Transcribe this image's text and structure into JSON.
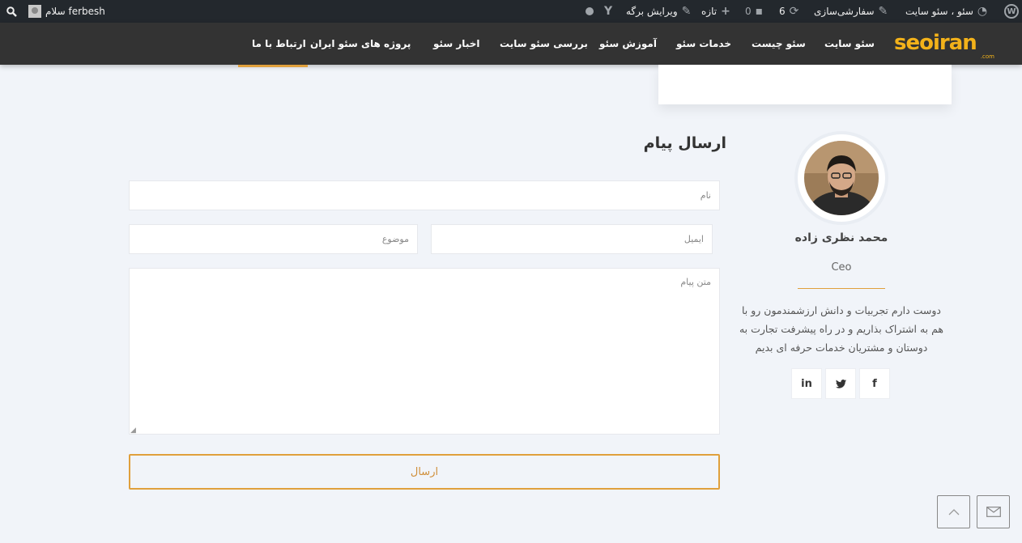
{
  "adminbar": {
    "site_name": "سئو ، سئو سایت",
    "customize": "سفارشی‌سازی",
    "updates_count": "6",
    "comments_count": "0",
    "new_label": "تازه",
    "edit_page": "ویرایش برگه",
    "greeting": "سلام ferbesh"
  },
  "logo": {
    "text": "seoiran",
    "sub": ".com"
  },
  "nav": {
    "items": [
      {
        "label": "سئو سایت"
      },
      {
        "label": "سئو چیست"
      },
      {
        "label": "خدمات سئو"
      },
      {
        "label": "آموزش سئو"
      },
      {
        "label": "بررسی سئو سایت"
      },
      {
        "label": "اخبار سئو"
      },
      {
        "label": "پروژه های سئو ایران"
      },
      {
        "label": "ارتباط با ما"
      }
    ]
  },
  "form": {
    "title": "ارسال پیام",
    "name_placeholder": "نام",
    "email_placeholder": "ایمیل",
    "subject_placeholder": "موضوع",
    "message_placeholder": "متن پیام",
    "submit_label": "ارسال"
  },
  "profile": {
    "name": "محمد نظری زاده",
    "role": "Ceo",
    "bio": "دوست دارم تجربیات و دانش ارزشمندمون رو با هم به اشتراک بذاریم و در راه پیشرفت تجارت به دوستان و مشتریان خدمات حرفه ای بدیم",
    "social": {
      "facebook": "f",
      "twitter": "t",
      "linkedin": "in"
    }
  },
  "colors": {
    "accent": "#e0a03c",
    "header_bg": "#333333",
    "adminbar_bg": "#23282d",
    "page_bg": "#f1f4f9"
  }
}
